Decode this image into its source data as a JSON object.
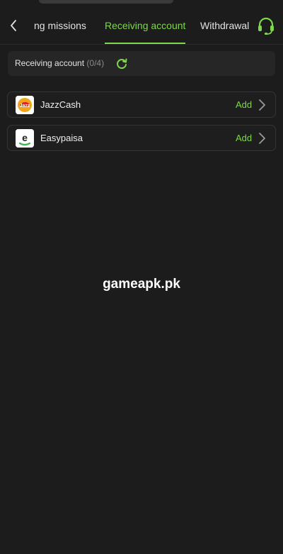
{
  "header": {
    "tabs": [
      {
        "label": "ng missions",
        "active": false
      },
      {
        "label": "Receiving account",
        "active": true
      },
      {
        "label": "Withdrawal l",
        "active": false
      }
    ],
    "accent_color": "#7dd84b"
  },
  "summary": {
    "label": "Receiving account",
    "count": "(0/4)"
  },
  "accounts": [
    {
      "name": "JazzCash",
      "action": "Add",
      "logo_text": "Jazz"
    },
    {
      "name": "Easypaisa",
      "action": "Add",
      "logo_text": "e"
    }
  ],
  "watermark": "gameapk.pk",
  "icons": [
    "back-arrow-icon",
    "headset-icon",
    "refresh-icon",
    "chevron-right-icon"
  ]
}
